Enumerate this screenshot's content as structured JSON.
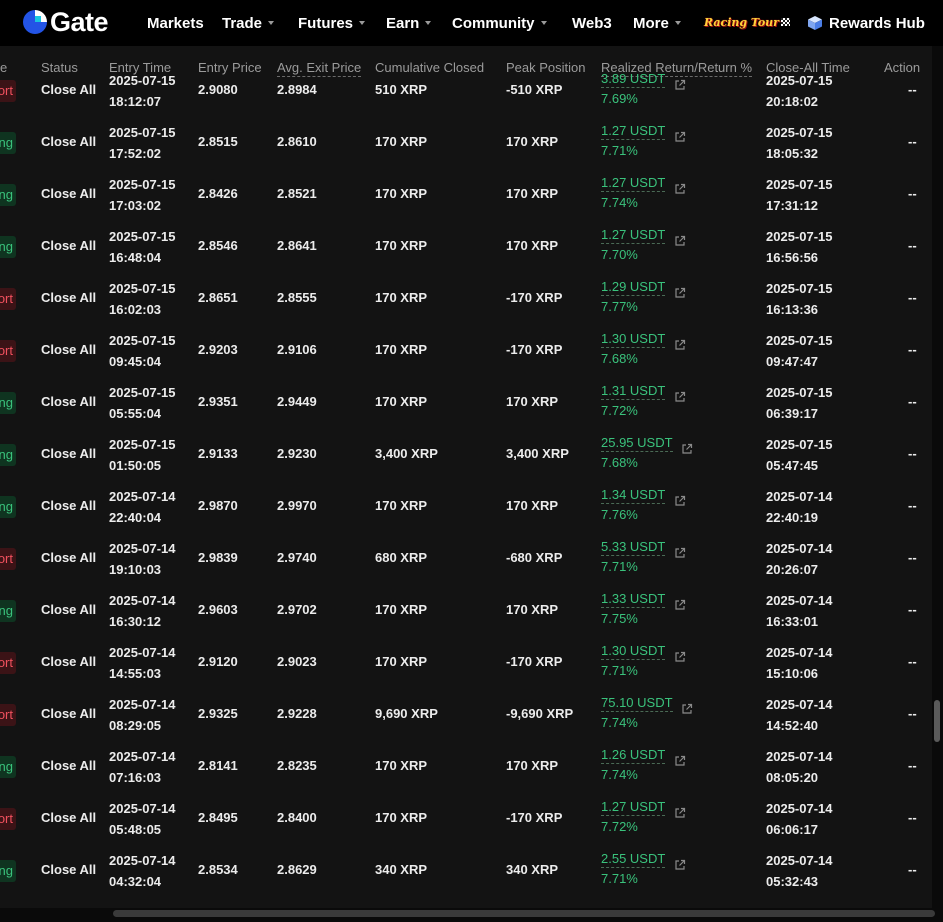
{
  "nav": {
    "brand": "Gate",
    "items": [
      {
        "label": "Markets",
        "caret": false
      },
      {
        "label": "Trade",
        "caret": true
      },
      {
        "label": "Futures",
        "caret": true
      },
      {
        "label": "Earn",
        "caret": true
      },
      {
        "label": "Community",
        "caret": true
      },
      {
        "label": "Web3",
        "caret": false
      },
      {
        "label": "More",
        "caret": true
      }
    ],
    "promo": "Racing Tour",
    "rewards": "Rewards Hub"
  },
  "table": {
    "headers": {
      "side": "e",
      "status": "Status",
      "entry_time": "Entry Time",
      "entry_price": "Entry Price",
      "exit_price": "Avg. Exit Price",
      "cum_closed": "Cumulative Closed",
      "peak": "Peak Position",
      "realized": "Realized Return/Return %",
      "close_time": "Close-All Time",
      "action": "Action"
    },
    "rows": [
      {
        "side": "ort",
        "side_type": "short",
        "status": "Close All",
        "entry_date": "2025-07-15",
        "entry_clock": "18:12:07",
        "entry_price": "2.9080",
        "exit_price": "2.8984",
        "closed": "510 XRP",
        "peak": "-510 XRP",
        "ret_amt": "3.89 USDT",
        "ret_pct": "7.69%",
        "close_date": "2025-07-15",
        "close_clock": "20:18:02",
        "action": "--"
      },
      {
        "side": "ng",
        "side_type": "long",
        "status": "Close All",
        "entry_date": "2025-07-15",
        "entry_clock": "17:52:02",
        "entry_price": "2.8515",
        "exit_price": "2.8610",
        "closed": "170 XRP",
        "peak": "170 XRP",
        "ret_amt": "1.27 USDT",
        "ret_pct": "7.71%",
        "close_date": "2025-07-15",
        "close_clock": "18:05:32",
        "action": "--"
      },
      {
        "side": "ng",
        "side_type": "long",
        "status": "Close All",
        "entry_date": "2025-07-15",
        "entry_clock": "17:03:02",
        "entry_price": "2.8426",
        "exit_price": "2.8521",
        "closed": "170 XRP",
        "peak": "170 XRP",
        "ret_amt": "1.27 USDT",
        "ret_pct": "7.74%",
        "close_date": "2025-07-15",
        "close_clock": "17:31:12",
        "action": "--"
      },
      {
        "side": "ng",
        "side_type": "long",
        "status": "Close All",
        "entry_date": "2025-07-15",
        "entry_clock": "16:48:04",
        "entry_price": "2.8546",
        "exit_price": "2.8641",
        "closed": "170 XRP",
        "peak": "170 XRP",
        "ret_amt": "1.27 USDT",
        "ret_pct": "7.70%",
        "close_date": "2025-07-15",
        "close_clock": "16:56:56",
        "action": "--"
      },
      {
        "side": "ort",
        "side_type": "short",
        "status": "Close All",
        "entry_date": "2025-07-15",
        "entry_clock": "16:02:03",
        "entry_price": "2.8651",
        "exit_price": "2.8555",
        "closed": "170 XRP",
        "peak": "-170 XRP",
        "ret_amt": "1.29 USDT",
        "ret_pct": "7.77%",
        "close_date": "2025-07-15",
        "close_clock": "16:13:36",
        "action": "--"
      },
      {
        "side": "ort",
        "side_type": "short",
        "status": "Close All",
        "entry_date": "2025-07-15",
        "entry_clock": "09:45:04",
        "entry_price": "2.9203",
        "exit_price": "2.9106",
        "closed": "170 XRP",
        "peak": "-170 XRP",
        "ret_amt": "1.30 USDT",
        "ret_pct": "7.68%",
        "close_date": "2025-07-15",
        "close_clock": "09:47:47",
        "action": "--"
      },
      {
        "side": "ng",
        "side_type": "long",
        "status": "Close All",
        "entry_date": "2025-07-15",
        "entry_clock": "05:55:04",
        "entry_price": "2.9351",
        "exit_price": "2.9449",
        "closed": "170 XRP",
        "peak": "170 XRP",
        "ret_amt": "1.31 USDT",
        "ret_pct": "7.72%",
        "close_date": "2025-07-15",
        "close_clock": "06:39:17",
        "action": "--"
      },
      {
        "side": "ng",
        "side_type": "long",
        "status": "Close All",
        "entry_date": "2025-07-15",
        "entry_clock": "01:50:05",
        "entry_price": "2.9133",
        "exit_price": "2.9230",
        "closed": "3,400 XRP",
        "peak": "3,400 XRP",
        "ret_amt": "25.95 USDT",
        "ret_pct": "7.68%",
        "close_date": "2025-07-15",
        "close_clock": "05:47:45",
        "action": "--"
      },
      {
        "side": "ng",
        "side_type": "long",
        "status": "Close All",
        "entry_date": "2025-07-14",
        "entry_clock": "22:40:04",
        "entry_price": "2.9870",
        "exit_price": "2.9970",
        "closed": "170 XRP",
        "peak": "170 XRP",
        "ret_amt": "1.34 USDT",
        "ret_pct": "7.76%",
        "close_date": "2025-07-14",
        "close_clock": "22:40:19",
        "action": "--"
      },
      {
        "side": "ort",
        "side_type": "short",
        "status": "Close All",
        "entry_date": "2025-07-14",
        "entry_clock": "19:10:03",
        "entry_price": "2.9839",
        "exit_price": "2.9740",
        "closed": "680 XRP",
        "peak": "-680 XRP",
        "ret_amt": "5.33 USDT",
        "ret_pct": "7.71%",
        "close_date": "2025-07-14",
        "close_clock": "20:26:07",
        "action": "--"
      },
      {
        "side": "ng",
        "side_type": "long",
        "status": "Close All",
        "entry_date": "2025-07-14",
        "entry_clock": "16:30:12",
        "entry_price": "2.9603",
        "exit_price": "2.9702",
        "closed": "170 XRP",
        "peak": "170 XRP",
        "ret_amt": "1.33 USDT",
        "ret_pct": "7.75%",
        "close_date": "2025-07-14",
        "close_clock": "16:33:01",
        "action": "--"
      },
      {
        "side": "ort",
        "side_type": "short",
        "status": "Close All",
        "entry_date": "2025-07-14",
        "entry_clock": "14:55:03",
        "entry_price": "2.9120",
        "exit_price": "2.9023",
        "closed": "170 XRP",
        "peak": "-170 XRP",
        "ret_amt": "1.30 USDT",
        "ret_pct": "7.71%",
        "close_date": "2025-07-14",
        "close_clock": "15:10:06",
        "action": "--"
      },
      {
        "side": "ort",
        "side_type": "short",
        "status": "Close All",
        "entry_date": "2025-07-14",
        "entry_clock": "08:29:05",
        "entry_price": "2.9325",
        "exit_price": "2.9228",
        "closed": "9,690 XRP",
        "peak": "-9,690 XRP",
        "ret_amt": "75.10 USDT",
        "ret_pct": "7.74%",
        "close_date": "2025-07-14",
        "close_clock": "14:52:40",
        "action": "--"
      },
      {
        "side": "ng",
        "side_type": "long",
        "status": "Close All",
        "entry_date": "2025-07-14",
        "entry_clock": "07:16:03",
        "entry_price": "2.8141",
        "exit_price": "2.8235",
        "closed": "170 XRP",
        "peak": "170 XRP",
        "ret_amt": "1.26 USDT",
        "ret_pct": "7.74%",
        "close_date": "2025-07-14",
        "close_clock": "08:05:20",
        "action": "--"
      },
      {
        "side": "ort",
        "side_type": "short",
        "status": "Close All",
        "entry_date": "2025-07-14",
        "entry_clock": "05:48:05",
        "entry_price": "2.8495",
        "exit_price": "2.8400",
        "closed": "170 XRP",
        "peak": "-170 XRP",
        "ret_amt": "1.27 USDT",
        "ret_pct": "7.72%",
        "close_date": "2025-07-14",
        "close_clock": "06:06:17",
        "action": "--"
      },
      {
        "side": "ng",
        "side_type": "long",
        "status": "Close All",
        "entry_date": "2025-07-14",
        "entry_clock": "04:32:04",
        "entry_price": "2.8534",
        "exit_price": "2.8629",
        "closed": "340 XRP",
        "peak": "340 XRP",
        "ret_amt": "2.55 USDT",
        "ret_pct": "7.71%",
        "close_date": "2025-07-14",
        "close_clock": "05:32:43",
        "action": "--"
      }
    ]
  },
  "colors": {
    "profit_green": "#3ac27c",
    "short_red": "#f0515e",
    "brand_blue": "#2354e6"
  }
}
